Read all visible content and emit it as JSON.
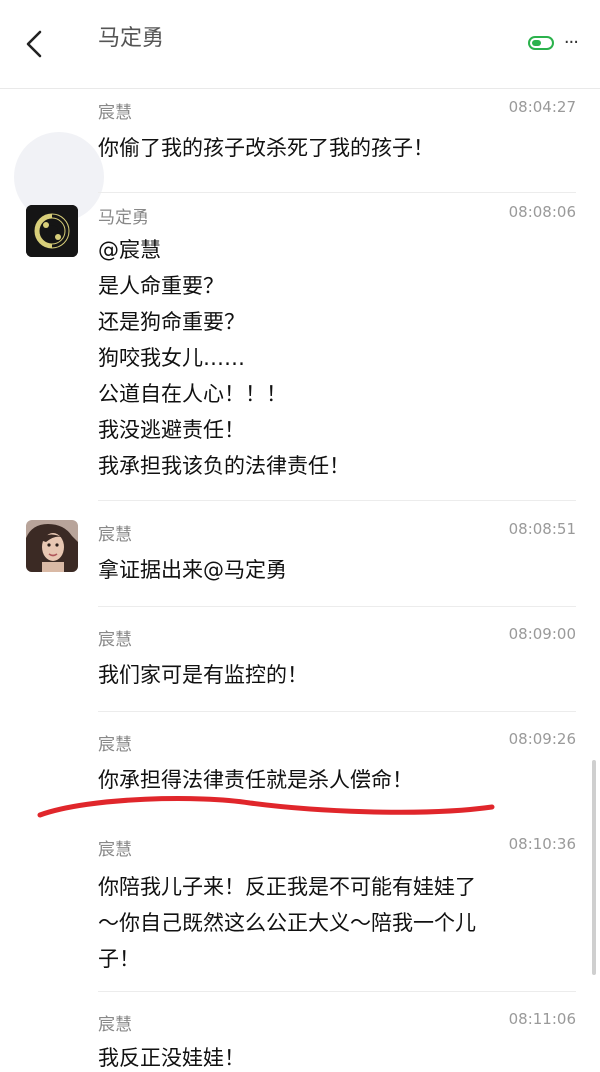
{
  "header": {
    "title": "马定勇",
    "back_icon": "chevron-left-icon",
    "more_label": "···"
  },
  "messages": [
    {
      "sender": "宸慧",
      "time": "08:04:27",
      "lines": [
        "你偷了我的孩子改杀死了我的孩子！"
      ]
    },
    {
      "sender": "马定勇",
      "time": "08:08:06",
      "lines": [
        "@宸慧",
        "是人命重要？",
        "还是狗命重要？",
        "狗咬我女儿……",
        "公道自在人心！！！",
        "我没逃避责任！",
        "我承担我该负的法律责任！"
      ]
    },
    {
      "sender": "宸慧",
      "time": "08:08:51",
      "lines": [
        "拿证据出来@马定勇"
      ]
    },
    {
      "sender": "宸慧",
      "time": "08:09:00",
      "lines": [
        "我们家可是有监控的！"
      ]
    },
    {
      "sender": "宸慧",
      "time": "08:09:26",
      "lines": [
        "你承担得法律责任就是杀人偿命！"
      ]
    },
    {
      "sender": "宸慧",
      "time": "08:10:36",
      "lines": [
        "你陪我儿子来！反正我是不可能有娃娃了",
        "～你自己既然这么公正大义～陪我一个儿",
        "子！"
      ]
    },
    {
      "sender": "宸慧",
      "time": "08:11:06",
      "lines": [
        "我反正没娃娃！"
      ]
    }
  ],
  "colors": {
    "annotation_red": "#e0262b",
    "toggle_green": "#2bb24c"
  }
}
